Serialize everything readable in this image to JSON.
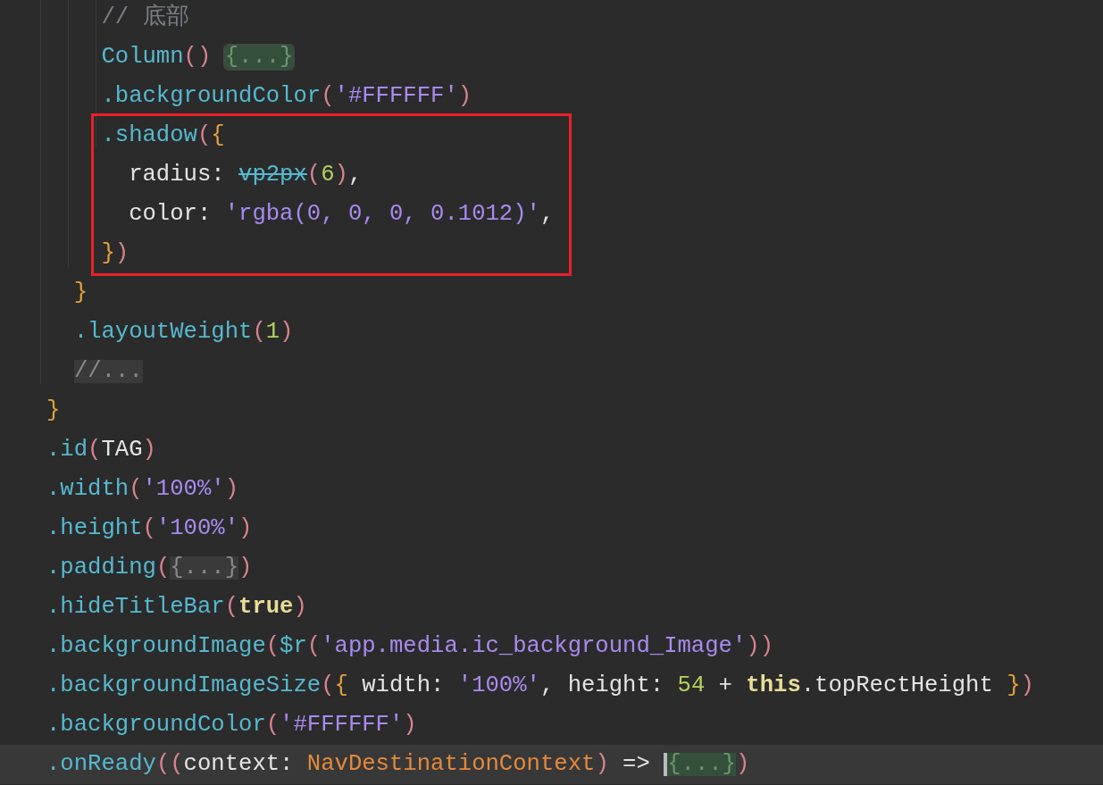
{
  "editor": {
    "blocks": [
      {
        "boxed": false,
        "lines": [
          {
            "tokens": [
              {
                "kind": "comment",
                "text": "    // 底部"
              }
            ]
          },
          {
            "tokens": [
              {
                "kind": "method",
                "text": "    Column"
              },
              {
                "kind": "paren",
                "text": "() "
              },
              {
                "kind": "fold",
                "text": "{...}"
              }
            ]
          },
          {
            "tokens": [
              {
                "kind": "method",
                "text": "    .backgroundColor"
              },
              {
                "kind": "paren",
                "text": "("
              },
              {
                "kind": "string",
                "text": "'#FFFFFF'"
              },
              {
                "kind": "paren",
                "text": ")"
              }
            ]
          }
        ]
      },
      {
        "boxed": true,
        "lines": [
          {
            "tokens": [
              {
                "kind": "method",
                "text": "    .shadow"
              },
              {
                "kind": "paren",
                "text": "("
              },
              {
                "kind": "brace",
                "text": "{"
              }
            ]
          },
          {
            "tokens": [
              {
                "kind": "plain",
                "text": "      radius: "
              },
              {
                "kind": "deprecated",
                "text": "vp2px"
              },
              {
                "kind": "paren",
                "text": "("
              },
              {
                "kind": "number",
                "text": "6"
              },
              {
                "kind": "paren",
                "text": ")"
              },
              {
                "kind": "plain",
                "text": ","
              }
            ]
          },
          {
            "tokens": [
              {
                "kind": "plain",
                "text": "      color: "
              },
              {
                "kind": "string",
                "text": "'rgba(0, 0, 0, 0.1012)'"
              },
              {
                "kind": "plain",
                "text": ","
              }
            ]
          },
          {
            "tokens": [
              {
                "kind": "brace",
                "text": "    }"
              },
              {
                "kind": "paren",
                "text": ")"
              }
            ]
          }
        ]
      },
      {
        "boxed": false,
        "lines": [
          {
            "tokens": [
              {
                "kind": "brace",
                "text": "  }"
              }
            ]
          },
          {
            "tokens": [
              {
                "kind": "method",
                "text": "  .layoutWeight"
              },
              {
                "kind": "paren",
                "text": "("
              },
              {
                "kind": "number",
                "text": "1"
              },
              {
                "kind": "paren",
                "text": ")"
              }
            ]
          },
          {
            "tokens": [
              {
                "kind": "fold_gray",
                "text": "//..."
              }
            ]
          },
          {
            "tokens": [
              {
                "kind": "brace",
                "text": "}"
              }
            ]
          },
          {
            "tokens": [
              {
                "kind": "method",
                "text": ".id"
              },
              {
                "kind": "paren",
                "text": "("
              },
              {
                "kind": "plain",
                "text": "TAG"
              },
              {
                "kind": "paren",
                "text": ")"
              }
            ]
          },
          {
            "tokens": [
              {
                "kind": "method",
                "text": ".width"
              },
              {
                "kind": "paren",
                "text": "("
              },
              {
                "kind": "string",
                "text": "'100%'"
              },
              {
                "kind": "paren",
                "text": ")"
              }
            ]
          },
          {
            "tokens": [
              {
                "kind": "method",
                "text": ".height"
              },
              {
                "kind": "paren",
                "text": "("
              },
              {
                "kind": "string",
                "text": "'100%'"
              },
              {
                "kind": "paren",
                "text": ")"
              }
            ]
          },
          {
            "tokens": [
              {
                "kind": "method",
                "text": ".padding"
              },
              {
                "kind": "paren",
                "text": "("
              },
              {
                "kind": "fold_gray",
                "text": "{...}"
              },
              {
                "kind": "paren",
                "text": ")"
              }
            ]
          },
          {
            "tokens": [
              {
                "kind": "method",
                "text": ".hideTitleBar"
              },
              {
                "kind": "paren",
                "text": "("
              },
              {
                "kind": "keyword",
                "text": "true"
              },
              {
                "kind": "paren",
                "text": ")"
              }
            ]
          },
          {
            "tokens": [
              {
                "kind": "method",
                "text": ".backgroundImage"
              },
              {
                "kind": "paren",
                "text": "("
              },
              {
                "kind": "method",
                "text": "$r"
              },
              {
                "kind": "paren",
                "text": "("
              },
              {
                "kind": "string",
                "text": "'app.media.ic_background_Image'"
              },
              {
                "kind": "paren",
                "text": "))"
              }
            ]
          },
          {
            "tokens": [
              {
                "kind": "method",
                "text": ".backgroundImageSize"
              },
              {
                "kind": "paren",
                "text": "("
              },
              {
                "kind": "brace",
                "text": "{"
              },
              {
                "kind": "plain",
                "text": " width: "
              },
              {
                "kind": "string",
                "text": "'100%'"
              },
              {
                "kind": "plain",
                "text": ", height: "
              },
              {
                "kind": "number",
                "text": "54"
              },
              {
                "kind": "plain",
                "text": " + "
              },
              {
                "kind": "keyword",
                "text": "this"
              },
              {
                "kind": "plain",
                "text": ".topRectHeight "
              },
              {
                "kind": "brace",
                "text": "}"
              },
              {
                "kind": "paren",
                "text": ")"
              }
            ]
          },
          {
            "tokens": [
              {
                "kind": "method",
                "text": ".backgroundColor"
              },
              {
                "kind": "paren",
                "text": "("
              },
              {
                "kind": "string",
                "text": "'#FFFFFF'"
              },
              {
                "kind": "paren",
                "text": ")"
              }
            ]
          },
          {
            "current": true,
            "tokens": [
              {
                "kind": "method",
                "text": ".onReady"
              },
              {
                "kind": "paren",
                "text": "(("
              },
              {
                "kind": "plain",
                "text": "context: "
              },
              {
                "kind": "type",
                "text": "NavDestinationContext"
              },
              {
                "kind": "paren",
                "text": ")"
              },
              {
                "kind": "plain",
                "text": " => "
              },
              {
                "kind": "fold_cursor",
                "text": "{...}"
              },
              {
                "kind": "paren",
                "text": ")"
              }
            ]
          }
        ]
      }
    ]
  }
}
